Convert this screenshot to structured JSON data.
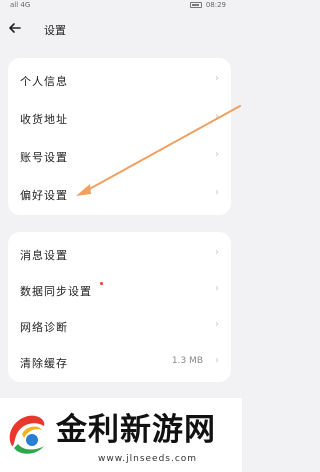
{
  "status_bar": {
    "left_text": "all 4G",
    "time": "08:29"
  },
  "header": {
    "title": "设置"
  },
  "group1": [
    {
      "label": "个人信息",
      "value": "",
      "dot": false
    },
    {
      "label": "收货地址",
      "value": "",
      "dot": false
    },
    {
      "label": "账号设置",
      "value": "",
      "dot": false
    },
    {
      "label": "偏好设置",
      "value": "",
      "dot": false
    }
  ],
  "group2": [
    {
      "label": "消息设置",
      "value": "",
      "dot": false
    },
    {
      "label": "数据同步设置",
      "value": "",
      "dot": true
    },
    {
      "label": "网络诊断",
      "value": "",
      "dot": false
    },
    {
      "label": "清除缓存",
      "value": "1.3 MB",
      "dot": false
    }
  ],
  "chevron": "›",
  "colors": {
    "arrow": "#f0a060",
    "dot": "#ff3b30"
  },
  "watermark": {
    "title": "金利新游网",
    "url": "www.jlnseeds.com"
  }
}
